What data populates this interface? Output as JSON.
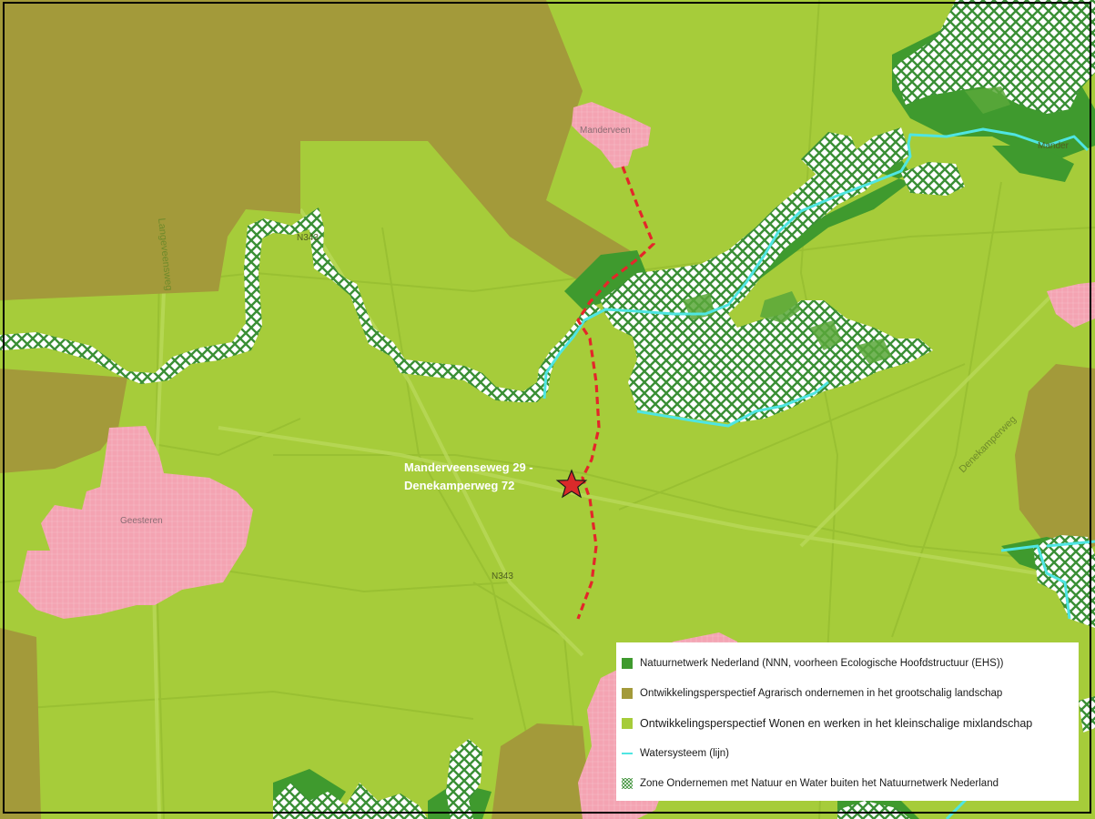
{
  "colors": {
    "mixlandscape": "#a6cc3a",
    "agrarisch": "#a39a3a",
    "natuurnetwerk": "#3f9a2e",
    "urban": "#f4a3b2",
    "water": "#4fe5e2",
    "hatch": "#3a8f35",
    "route": "#e4262a",
    "marker": "#d92a2a"
  },
  "map": {
    "places": {
      "manderveen": "Manderveen",
      "geesteren": "Geesteren",
      "mander": "Mander"
    },
    "roads": {
      "langeveensweg": "Langeveensweg",
      "denekamperweg": "Denekamperweg",
      "n343_top": "N343",
      "n343_mid": "N343"
    },
    "location_label": [
      "Manderveenseweg 29 -",
      "Denekamperweg 72"
    ],
    "marker_icon": "star-icon"
  },
  "legend": {
    "items": [
      {
        "label": "Natuurnetwerk Nederland (NNN, voorheen Ecologische Hoofdstructuur (EHS))",
        "icon": "square-swatch"
      },
      {
        "label": "Ontwikkelingsperspectief Agrarisch ondernemen in het grootschalig landschap",
        "icon": "square-swatch"
      },
      {
        "label": "Ontwikkelingsperspectief Wonen en werken in het kleinschalige mixlandschap",
        "icon": "square-swatch"
      },
      {
        "label": "Watersysteem (lijn)",
        "icon": "line-swatch"
      },
      {
        "label": "Zone Ondernemen met Natuur en Water buiten het Natuurnetwerk Nederland",
        "icon": "hatch-swatch"
      }
    ]
  }
}
